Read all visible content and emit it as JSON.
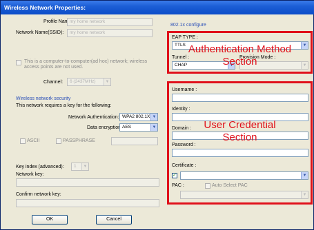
{
  "window": {
    "title": "Wireless Network Properties:"
  },
  "left": {
    "profile_name_label": "Profile Name:",
    "profile_name_value": "my home network",
    "ssid_label": "Network Name(SSID):",
    "ssid_value": "my home network",
    "adhoc_text_line1": "This is a computer-to-computer(ad hoc) network; wireless",
    "adhoc_text_line2": "access points are not used.",
    "channel_label": "Channel:",
    "channel_value": "6 (2437MHz)",
    "security_title": "Wireless network security",
    "security_desc": "This network requires a key for the following:",
    "auth_label": "Network Authentication:",
    "auth_value": "WPA2 802.1X",
    "enc_label": "Data encryption:",
    "enc_value": "AES",
    "ascii_label": "ASCII",
    "passphrase_label": "PASSPHRASE",
    "key_index_label": "Key index (advanced):",
    "key_index_value": "1",
    "network_key_label": "Network key:",
    "confirm_key_label": "Confirm network key:",
    "ok_label": "OK",
    "cancel_label": "Cancel"
  },
  "right": {
    "section_title": "802.1x configure",
    "eap_type_label": "EAP TYPE :",
    "eap_type_value": "TTLS",
    "tunnel_label": "Tunnel :",
    "provision_label": "Provision Mode :",
    "tunnel_value": "CHAP",
    "username_label": "Username :",
    "identity_label": "Identity :",
    "domain_label": "Domain :",
    "password_label": "Password :",
    "certificate_label": "Certificate :",
    "pac_label": "PAC :",
    "auto_pac_label": "Auto Select PAC"
  },
  "annotations": {
    "auth_line1": "Authentication Method",
    "auth_line2": "Section",
    "cred_line1": "User Credential",
    "cred_line2": "Section",
    "color": "#e0101a"
  }
}
